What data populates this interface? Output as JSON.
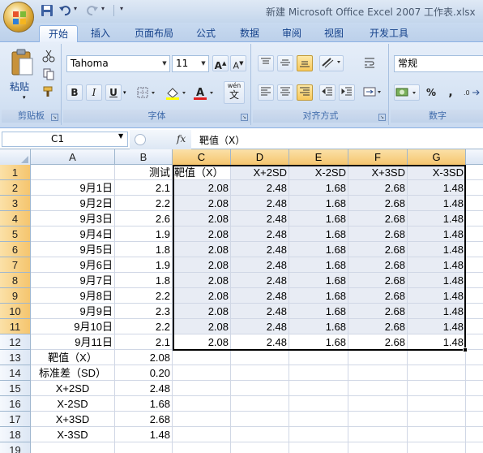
{
  "title_bar": {
    "title": "新建 Microsoft Office Excel 2007 工作表.xlsx"
  },
  "quick_access": {
    "dropdown_glyph": "▾"
  },
  "tabs": [
    "开始",
    "插入",
    "页面布局",
    "公式",
    "数据",
    "审阅",
    "视图",
    "开发工具"
  ],
  "ribbon": {
    "clipboard": {
      "paste_label": "粘贴",
      "group_label": "剪贴板"
    },
    "font": {
      "name": "Tahoma",
      "size": "11",
      "grow": "A",
      "shrink": "A",
      "bold": "B",
      "italic": "I",
      "underline": "U",
      "wen": "wén",
      "wen_glyph": "文",
      "group_label": "字体"
    },
    "alignment": {
      "group_label": "对齐方式"
    },
    "number": {
      "format": "常规",
      "percent": "%",
      "comma": ",",
      "group_label": "数字"
    }
  },
  "formula_bar": {
    "name_box": "C1",
    "fx": "fx",
    "formula": "靶值（X）"
  },
  "columns": [
    "A",
    "B",
    "C",
    "D",
    "E",
    "F",
    "G"
  ],
  "selected_columns": [
    "C",
    "D",
    "E",
    "F",
    "G"
  ],
  "rows": [
    {
      "n": "1",
      "cells": [
        "",
        "测试",
        "靶值（X）",
        "X+2SD",
        "X-2SD",
        "X+3SD",
        "X-3SD"
      ]
    },
    {
      "n": "2",
      "cells": [
        "9月1日",
        "2.1",
        "2.08",
        "2.48",
        "1.68",
        "2.68",
        "1.48"
      ]
    },
    {
      "n": "3",
      "cells": [
        "9月2日",
        "2.2",
        "2.08",
        "2.48",
        "1.68",
        "2.68",
        "1.48"
      ]
    },
    {
      "n": "4",
      "cells": [
        "9月3日",
        "2.6",
        "2.08",
        "2.48",
        "1.68",
        "2.68",
        "1.48"
      ]
    },
    {
      "n": "5",
      "cells": [
        "9月4日",
        "1.9",
        "2.08",
        "2.48",
        "1.68",
        "2.68",
        "1.48"
      ]
    },
    {
      "n": "6",
      "cells": [
        "9月5日",
        "1.8",
        "2.08",
        "2.48",
        "1.68",
        "2.68",
        "1.48"
      ]
    },
    {
      "n": "7",
      "cells": [
        "9月6日",
        "1.9",
        "2.08",
        "2.48",
        "1.68",
        "2.68",
        "1.48"
      ]
    },
    {
      "n": "8",
      "cells": [
        "9月7日",
        "1.8",
        "2.08",
        "2.48",
        "1.68",
        "2.68",
        "1.48"
      ]
    },
    {
      "n": "9",
      "cells": [
        "9月8日",
        "2.2",
        "2.08",
        "2.48",
        "1.68",
        "2.68",
        "1.48"
      ]
    },
    {
      "n": "10",
      "cells": [
        "9月9日",
        "2.3",
        "2.08",
        "2.48",
        "1.68",
        "2.68",
        "1.48"
      ]
    },
    {
      "n": "11",
      "cells": [
        "9月10日",
        "2.2",
        "2.08",
        "2.48",
        "1.68",
        "2.68",
        "1.48"
      ]
    },
    {
      "n": "12",
      "cells": [
        "9月11日",
        "2.1",
        "2.08",
        "2.48",
        "1.68",
        "2.68",
        "1.48"
      ]
    },
    {
      "n": "13",
      "cells": [
        "靶值（X）",
        "2.08",
        "",
        "",
        "",
        "",
        ""
      ]
    },
    {
      "n": "14",
      "cells": [
        "标准差（SD）",
        "0.20",
        "",
        "",
        "",
        "",
        ""
      ]
    },
    {
      "n": "15",
      "cells": [
        "X+2SD",
        "2.48",
        "",
        "",
        "",
        "",
        ""
      ]
    },
    {
      "n": "16",
      "cells": [
        "X-2SD",
        "1.68",
        "",
        "",
        "",
        "",
        ""
      ]
    },
    {
      "n": "17",
      "cells": [
        "X+3SD",
        "2.68",
        "",
        "",
        "",
        "",
        ""
      ]
    },
    {
      "n": "18",
      "cells": [
        "X-3SD",
        "1.48",
        "",
        "",
        "",
        "",
        ""
      ]
    },
    {
      "n": "19",
      "cells": [
        "",
        "",
        "",
        "",
        "",
        "",
        ""
      ]
    }
  ]
}
